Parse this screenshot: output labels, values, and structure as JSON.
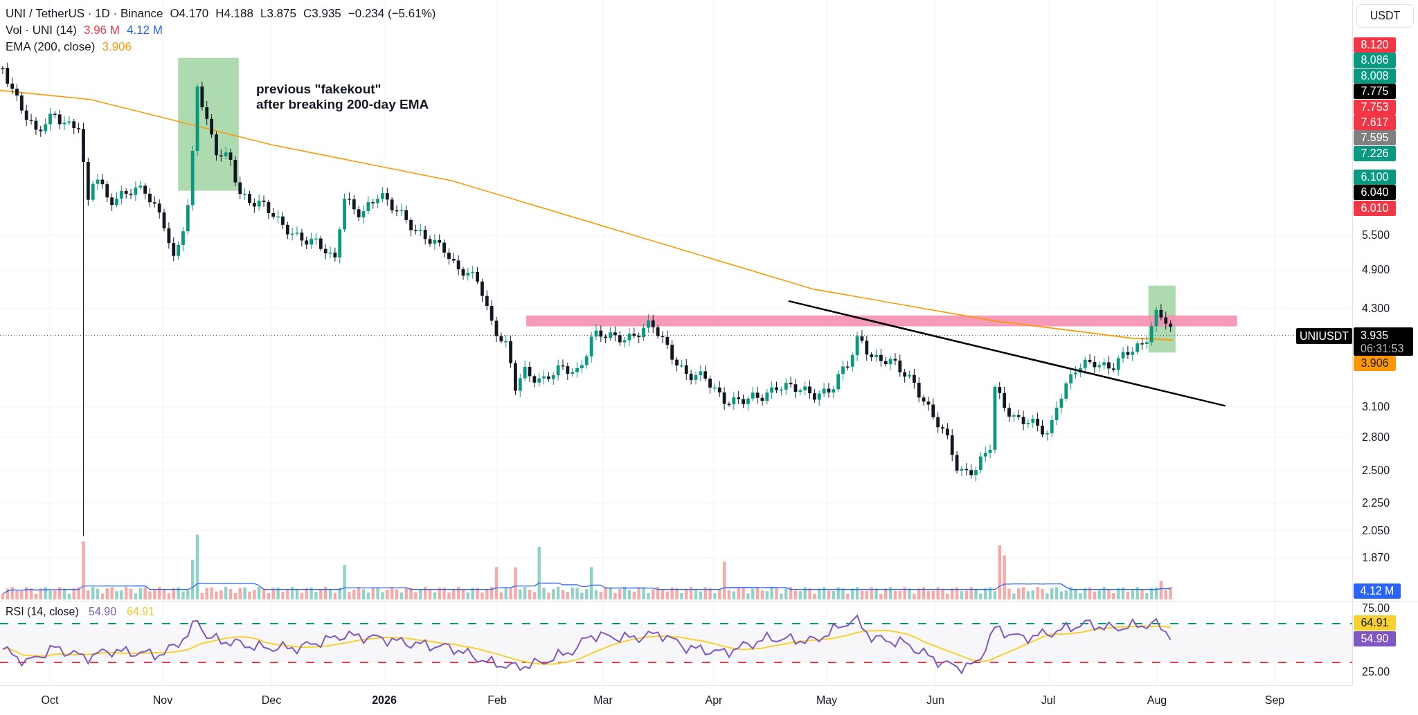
{
  "legend": {
    "symbol": "UNI / TetherUS · 1D · Binance",
    "open": "O4.170",
    "high": "H4.188",
    "low": "L3.875",
    "close": "C3.935",
    "change": "−0.234 (−5.61%)"
  },
  "volume_legend": {
    "label": "Vol · UNI (14)",
    "value": "3.96 M",
    "average": "4.12 M"
  },
  "ema_legend": {
    "label": "EMA (200, close)",
    "value": "3.906"
  },
  "currency_button": "USDT",
  "annotation": [
    "previous \"fakekout\"",
    "after breaking 200-day EMA"
  ],
  "price_tags": [
    {
      "text": "8.120",
      "color": "#f23645"
    },
    {
      "text": "8.086",
      "color": "#089981"
    },
    {
      "text": "8.008",
      "color": "#089981"
    },
    {
      "text": "7.775",
      "color": "#000000"
    },
    {
      "text": "7.753",
      "color": "#f23645"
    },
    {
      "text": "7.617",
      "color": "#f23645"
    },
    {
      "text": "7.595",
      "color": "#808080"
    },
    {
      "text": "7.226",
      "color": "#089981"
    },
    {
      "text": "6.100",
      "color": "#089981"
    },
    {
      "text": "6.040",
      "color": "#000000"
    },
    {
      "text": "6.010",
      "color": "#f23645"
    }
  ],
  "price_axis": [
    "5.500",
    "4.900",
    "4.300",
    "3.100",
    "2.800",
    "2.500",
    "2.250",
    "2.050",
    "1.870"
  ],
  "symbol_tag": "UNIUSDT",
  "last_price": "3.935",
  "countdown": "06:31:53",
  "ema_tag": "3.906",
  "volume_tag": "4.12 M",
  "rsi": {
    "label": "RSI (14, close)",
    "value": "54.90",
    "average": "64.91",
    "axis": [
      "75.00",
      "25.00"
    ],
    "tags": [
      {
        "text": "64.91",
        "color": "#f7d22e"
      },
      {
        "text": "54.90",
        "color": "#7e57c2"
      }
    ]
  },
  "time_axis": [
    "Oct",
    "Nov",
    "Dec",
    "2026",
    "Feb",
    "Mar",
    "Apr",
    "May",
    "Jun",
    "Jul",
    "Aug",
    "Sep"
  ]
}
